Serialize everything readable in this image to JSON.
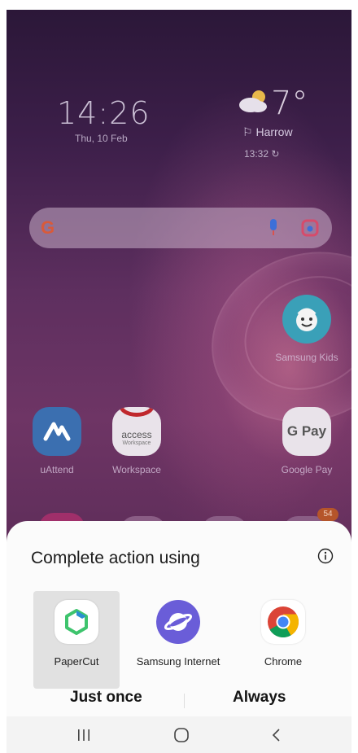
{
  "home": {
    "clock": "14:26",
    "date": "Thu, 10 Feb",
    "weather": {
      "temperature": "7°",
      "location": "Harrow",
      "updated": "13:32"
    },
    "search": {
      "logo": "G"
    },
    "apps": [
      {
        "label": "Samsung Kids",
        "icon": "samsung-kids-icon"
      },
      {
        "label": "uAttend",
        "icon": "uattend-icon"
      },
      {
        "label": "Workspace",
        "icon": "access-workspace-icon",
        "icon_text": "access",
        "icon_subtext": "Workspace"
      },
      {
        "label": "Google Pay",
        "icon": "google-pay-icon",
        "icon_text": "G Pay"
      }
    ],
    "badge_count": "54"
  },
  "sheet": {
    "title": "Complete action using",
    "options": [
      {
        "label": "PaperCut",
        "icon": "papercut-icon",
        "selected": true
      },
      {
        "label": "Samsung Internet",
        "icon": "samsung-internet-icon",
        "selected": false
      },
      {
        "label": "Chrome",
        "icon": "chrome-icon",
        "selected": false
      }
    ],
    "just_once_label": "Just once",
    "always_label": "Always"
  },
  "colors": {
    "sheet_bg": "#fbfbfb",
    "selected_bg": "#e1e1e1",
    "papercut_green": "#3ec46d",
    "samsung_internet": "#6a5dd8"
  }
}
